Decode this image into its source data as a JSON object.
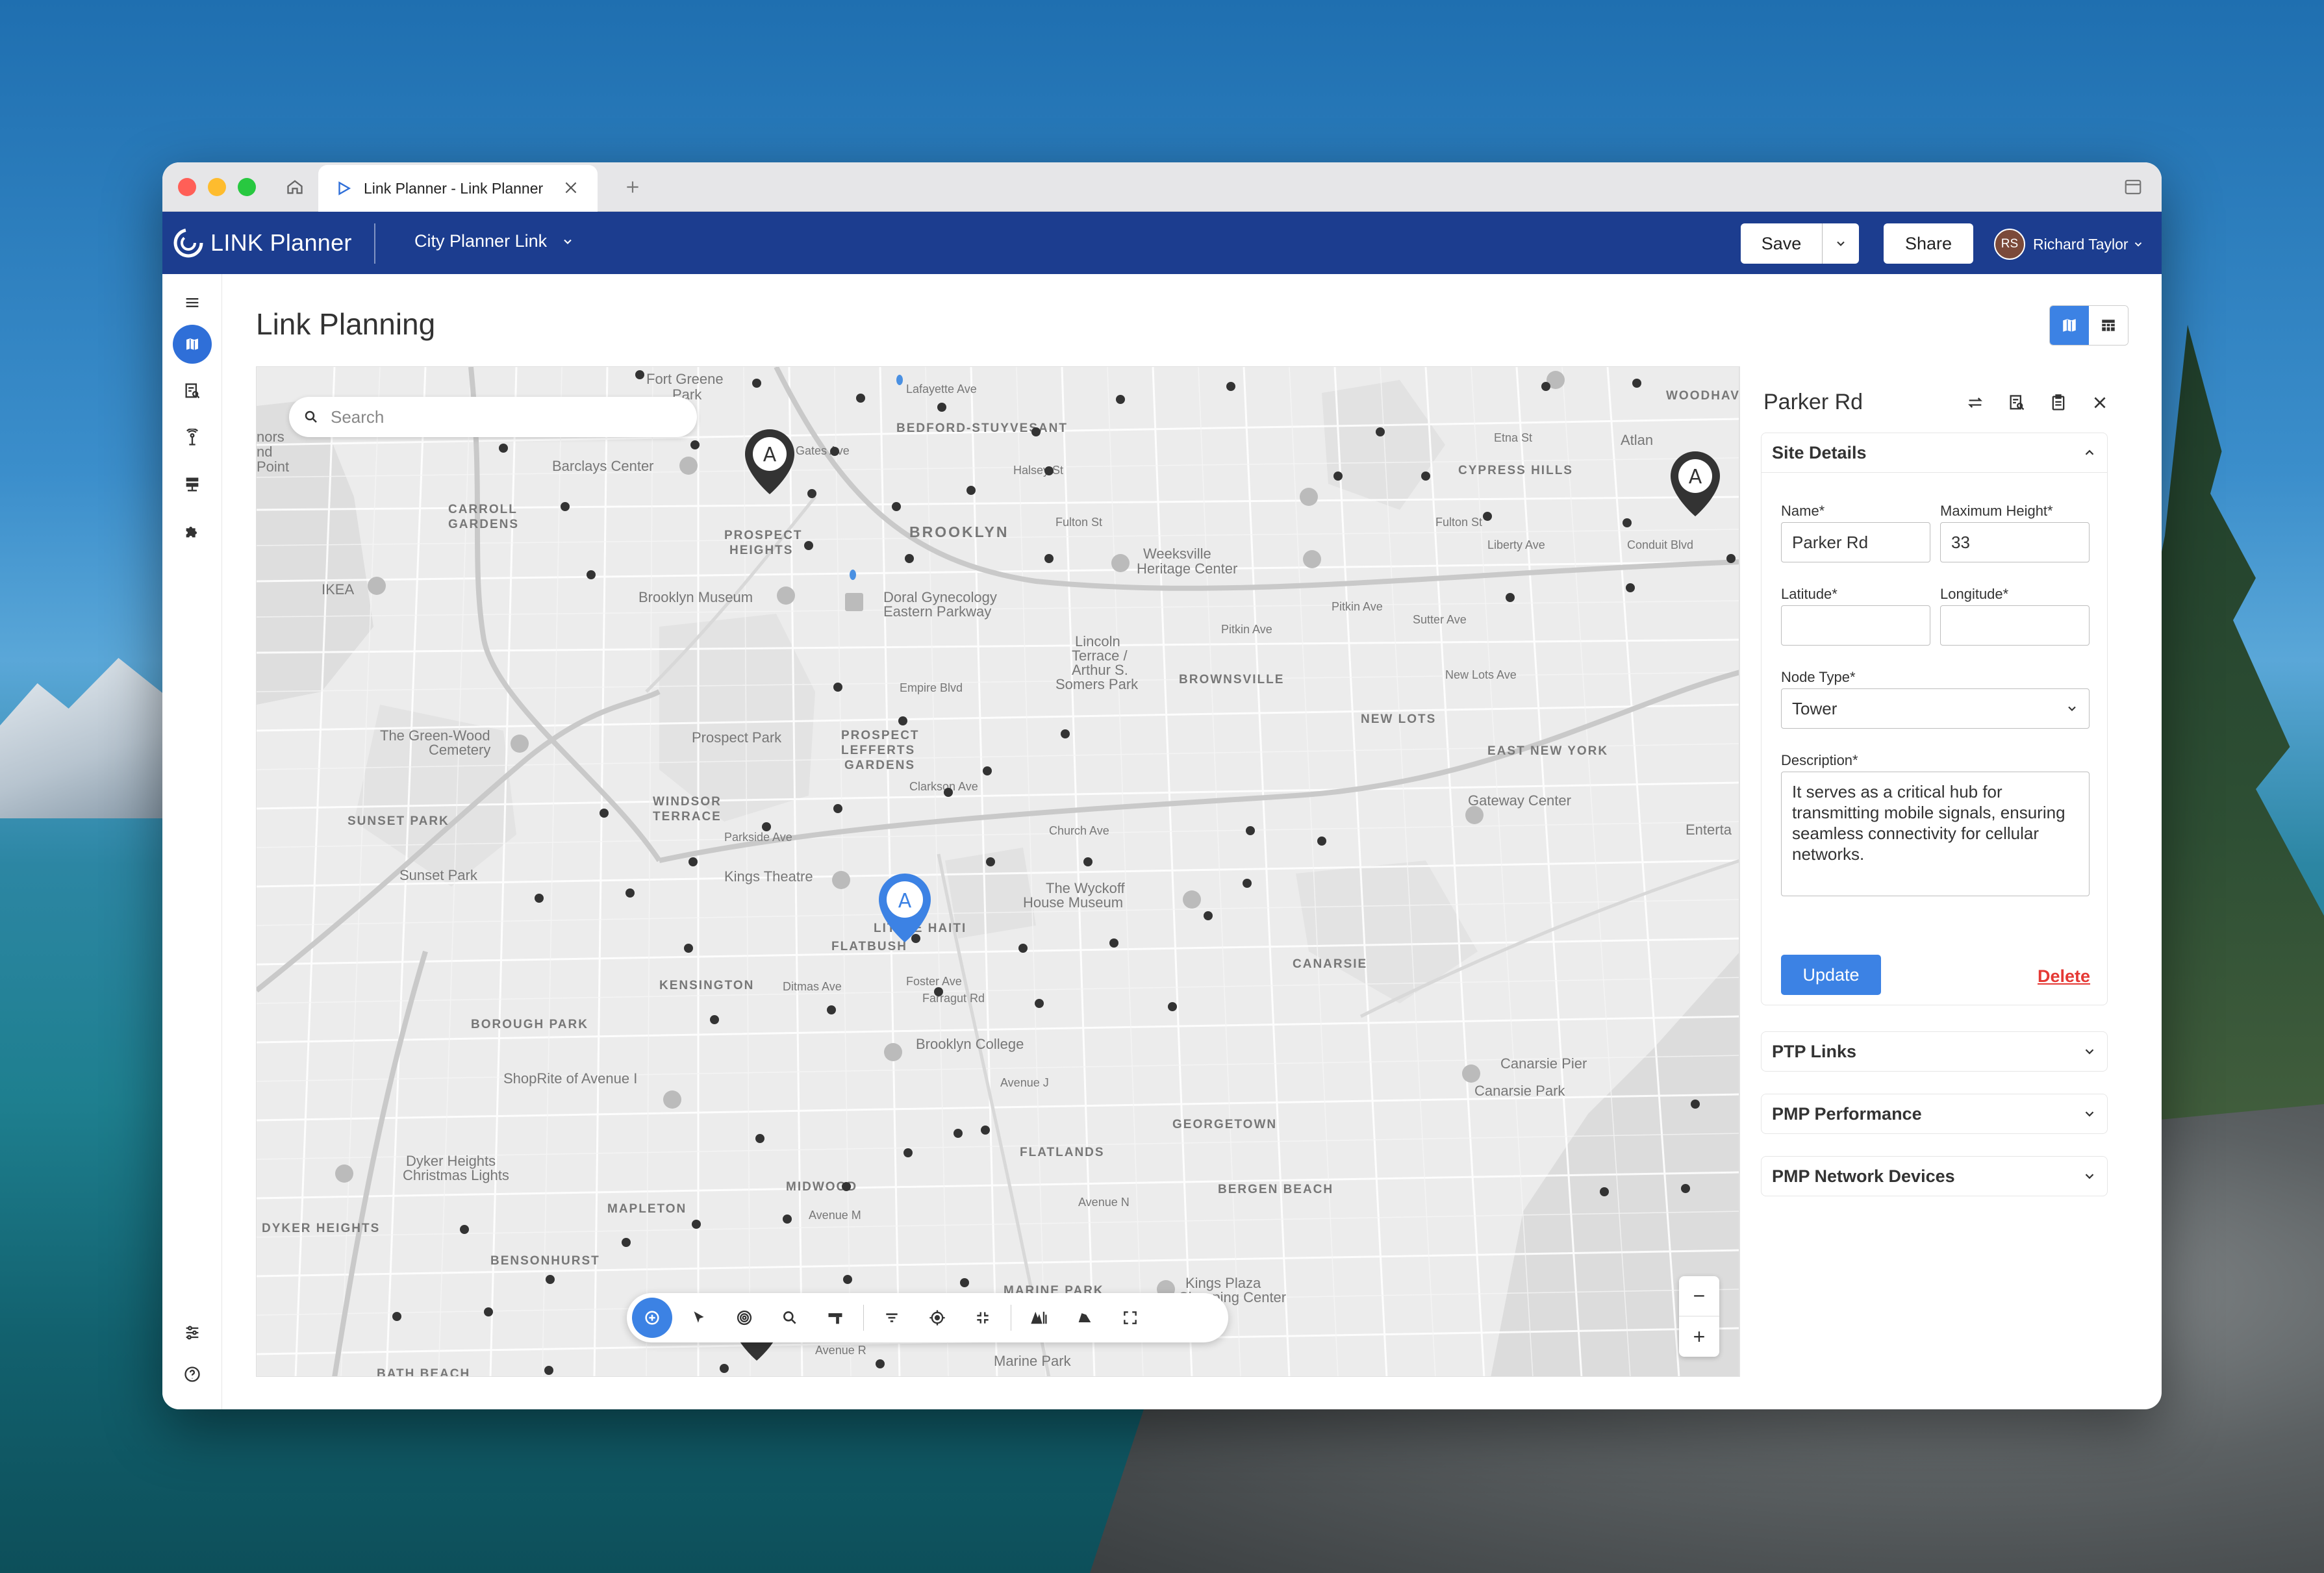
{
  "browser": {
    "tab_title": "Link Planner - Link Planner"
  },
  "header": {
    "brand": "LINK Planner",
    "project": "City Planner Link",
    "save_label": "Save",
    "share_label": "Share",
    "user_initials": "RS",
    "user_name": "Richard Taylor"
  },
  "page": {
    "title": "Link Planning"
  },
  "map": {
    "search_placeholder": "Search",
    "zoom_out": "−",
    "zoom_in": "+",
    "pin_letter": "A",
    "labels": {
      "fort_greene_park": "Fort Greene",
      "fort_greene_park2": "Park",
      "atlantic": "Atlan",
      "lafayette": "Lafayette Ave",
      "bedford": "BEDFORD-STUYVESANT",
      "woodhaven": "WOODHAVI",
      "gates": "Gates Ave",
      "halsey": "Halsey St",
      "etna": "Etna St",
      "cypress": "CYPRESS HILLS",
      "barclays": "Barclays Center",
      "carroll1": "CARROLL",
      "carroll2": "GARDENS",
      "prospect_heights1": "PROSPECT",
      "prospect_heights2": "HEIGHTS",
      "brooklyn": "BROOKLYN",
      "fulton": "Fulton St",
      "fulton2": "Fulton St",
      "weeksville1": "Weeksville",
      "weeksville2": "Heritage Center",
      "liberty": "Liberty Ave",
      "conduit": "Conduit Blvd",
      "ikea": "IKEA",
      "brooklyn_museum": "Brooklyn Museum",
      "doral1": "Doral Gynecology",
      "doral2": "Eastern Parkway",
      "pitkin": "Pitkin Ave",
      "pitkin2": "Pitkin Ave",
      "sutter": "Sutter Ave",
      "lincoln1": "Lincoln",
      "lincoln2": "Terrace /",
      "lincoln3": "Arthur S.",
      "lincoln4": "Somers Park",
      "brownsville": "BROWNSVILLE",
      "new_lots_ave": "New Lots Ave",
      "empire": "Empire Blvd",
      "greenwood1": "The Green-Wood",
      "greenwood2": "Cemetery",
      "prospect_park": "Prospect Park",
      "plg1": "PROSPECT",
      "plg2": "LEFFERTS",
      "plg3": "GARDENS",
      "new_lots": "NEW LOTS",
      "east_ny": "EAST NEW YORK",
      "clarkson": "Clarkson Ave",
      "windsor1": "WINDSOR",
      "windsor2": "TERRACE",
      "sunset_park_n": "SUNSET PARK",
      "gateway": "Gateway Center",
      "church": "Church Ave",
      "parkside": "Parkside Ave",
      "sunset_park": "Sunset Park",
      "kings_theatre": "Kings Theatre",
      "wyckoff1": "The Wyckoff",
      "wyckoff2": "House Museum",
      "flatbush": "FLATBUSH",
      "little_haiti": "LITTLE HAITI",
      "kensington": "KENSINGTON",
      "canarsie": "CANARSIE",
      "ditmas": "Ditmas Ave",
      "foster": "Foster Ave",
      "farragut": "Farragut Rd",
      "borough_park": "BOROUGH PARK",
      "brooklyn_college": "Brooklyn College",
      "canarsie_pier": "Canarsie Pier",
      "canarsie_park": "Canarsie Park",
      "shoprite": "ShopRite of Avenue I",
      "avenue_j": "Avenue J",
      "georgetown": "GEORGETOWN",
      "flatlands": "FLATLANDS",
      "dyker1": "Dyker Heights",
      "dyker2": "Christmas Lights",
      "midwood": "MIDWOOD",
      "avenue_m": "Avenue M",
      "bergen": "BERGEN BEACH",
      "dyker_heights": "DYKER HEIGHTS",
      "mapleton": "MAPLETON",
      "avenue_n": "Avenue N",
      "bensonhurst": "BENSONHURST",
      "marine_park_n": "MARINE PARK",
      "kings_plaza1": "Kings Plaza",
      "kings_plaza2": "Shopping Center",
      "marine_park": "Marine Park",
      "bath_beach": "BATH BEACH",
      "avenue_r": "Avenue R",
      "nors1": "nors",
      "nors2": "nd",
      "nors3": "Point",
      "enterta": "Enterta"
    }
  },
  "panel": {
    "title": "Parker Rd",
    "site_details_title": "Site Details",
    "name_label": "Name*",
    "name_value": "Parker Rd",
    "max_height_label": "Maximum Height*",
    "max_height_value": "33",
    "latitude_label": "Latitude*",
    "latitude_value": "",
    "longitude_label": "Longitude*",
    "longitude_value": "",
    "node_type_label": "Node Type*",
    "node_type_value": "Tower",
    "description_label": "Description*",
    "description_value": "It serves as a critical hub for transmitting mobile signals, ensuring seamless connectivity for cellular networks.",
    "update_label": "Update",
    "delete_label": "Delete",
    "sections": [
      "PTP Links",
      "PMP Performance",
      "PMP Network Devices"
    ]
  },
  "colors": {
    "brand_bar": "#1c3d8f",
    "accent": "#3c82e4",
    "danger": "#e53935"
  }
}
